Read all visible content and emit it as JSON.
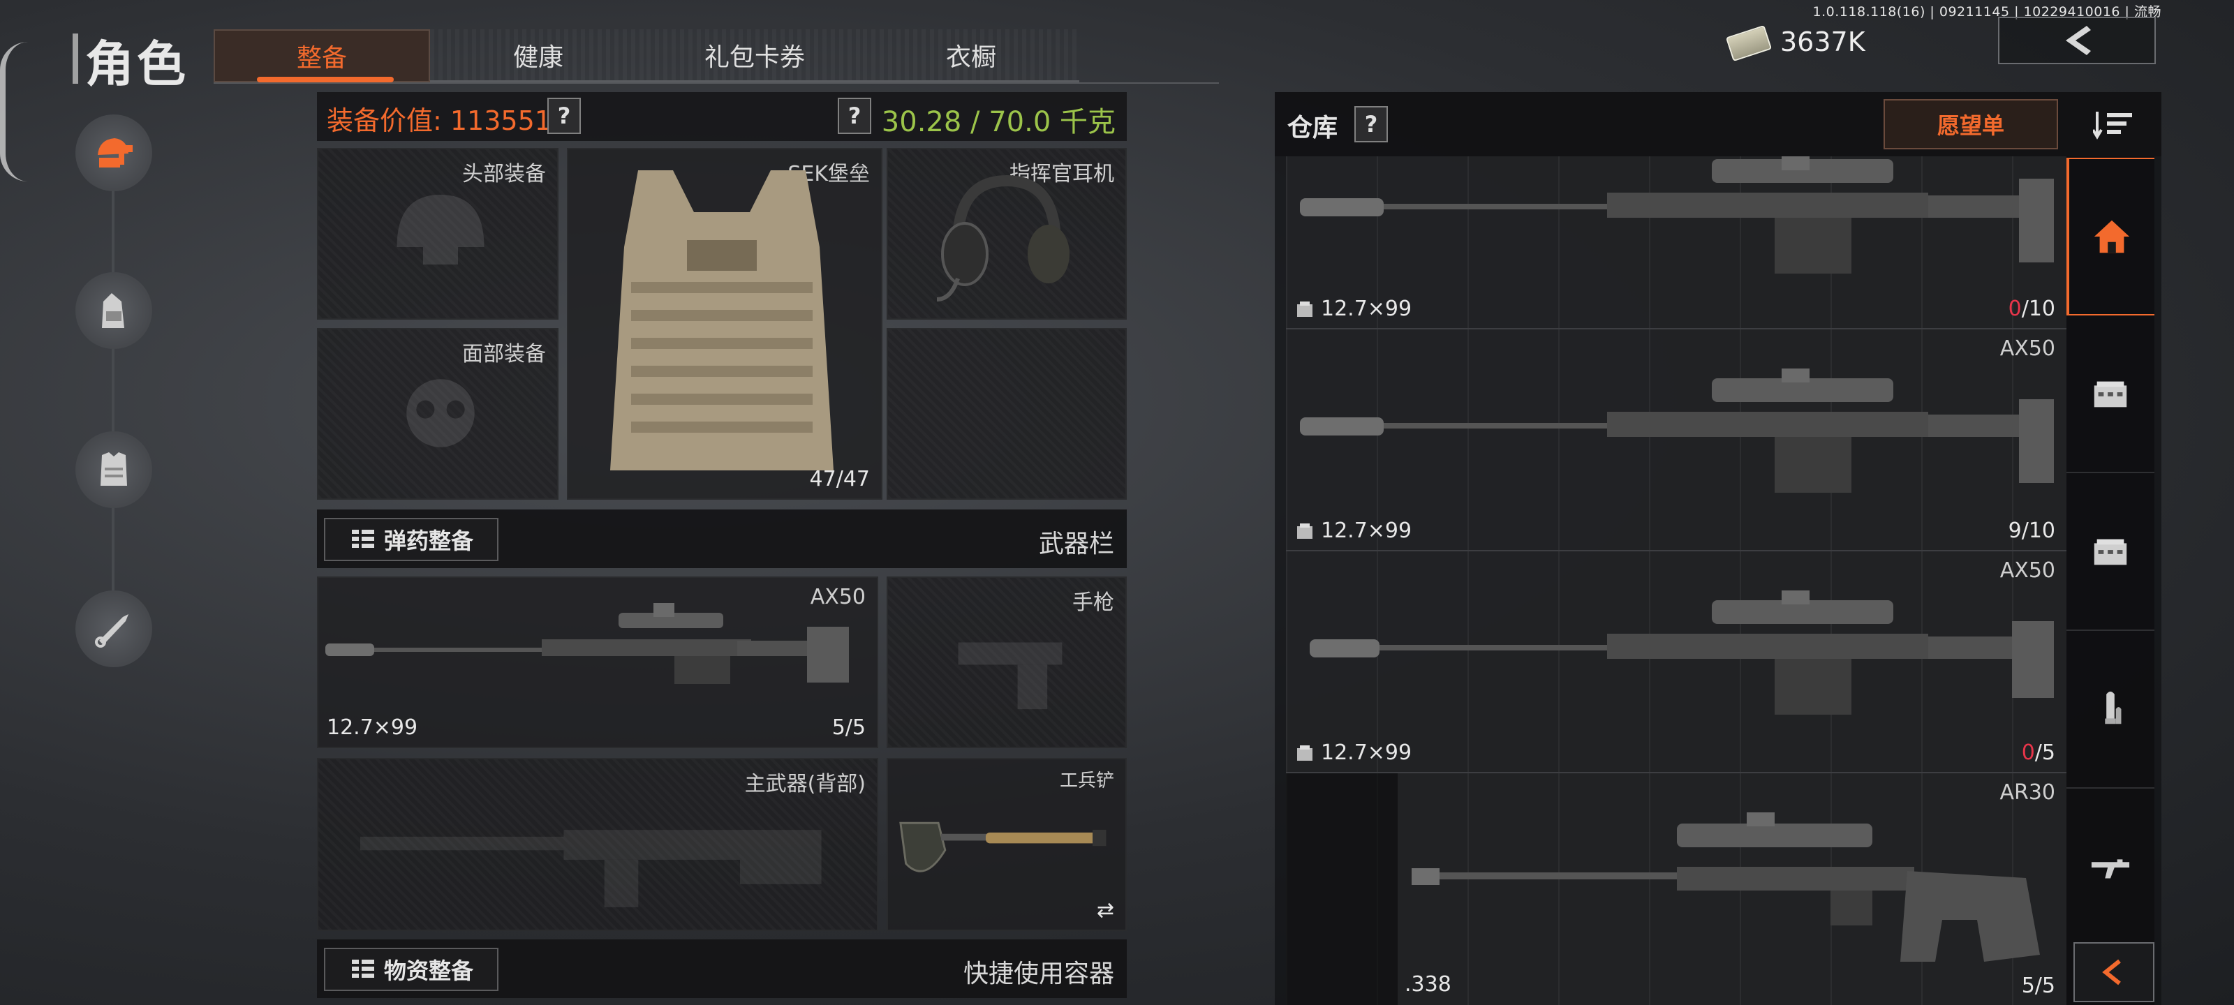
{
  "version": "1.0.118.118(16) | 09211145 | 10229410016 | 流畅",
  "page_title": "角色",
  "tabs": [
    {
      "label": "整备",
      "active": true
    },
    {
      "label": "健康",
      "active": false
    },
    {
      "label": "礼包卡券",
      "active": false
    },
    {
      "label": "衣橱",
      "active": false
    }
  ],
  "currency": {
    "amount": "3637K",
    "icon": "cash-icon"
  },
  "sidebar": [
    "helmet-gun-icon",
    "backpack-icon",
    "armor-icon",
    "melee-icon"
  ],
  "loadout": {
    "value_label": "装备价值: 113551",
    "help": "?",
    "weight": "30.28 / 70.0 千克",
    "weight_color": "#9cc44a",
    "head": {
      "label": "头部装备"
    },
    "face": {
      "label": "面部装备"
    },
    "armor": {
      "label": "SEK堡垒",
      "count": "47/47"
    },
    "headset": {
      "label": "指挥官耳机"
    },
    "ammo_button": "弹药整备",
    "weapon_section": "武器栏",
    "primary": {
      "label": "AX50",
      "ammo": "12.7×99",
      "count": "5/5"
    },
    "pistol": {
      "label": "手枪"
    },
    "back_weapon": {
      "label": "主武器(背部)"
    },
    "melee": {
      "label": "工兵铲",
      "swap": "⇄"
    },
    "supply_button": "物资整备",
    "container_section": "快捷使用容器"
  },
  "warehouse": {
    "title": "仓库",
    "help": "?",
    "wishlist": "愿望单",
    "items": [
      {
        "name": "",
        "ammo": "12.7×99",
        "count_used": "0",
        "count_total": "/10"
      },
      {
        "name": "AX50",
        "ammo": "12.7×99",
        "count_used": "9",
        "count_total": "/10"
      },
      {
        "name": "AX50",
        "ammo": "12.7×99",
        "count_used": "0",
        "count_total": "/5"
      },
      {
        "name": "AR30",
        "ammo": ".338",
        "count_used": "5",
        "count_total": "/5"
      }
    ]
  },
  "rail": [
    "home-icon",
    "crate-icon",
    "crate-icon",
    "ammo-icon",
    "rifle-icon"
  ],
  "colors": {
    "accent": "#f36a2d",
    "warn": "#e8354a"
  }
}
